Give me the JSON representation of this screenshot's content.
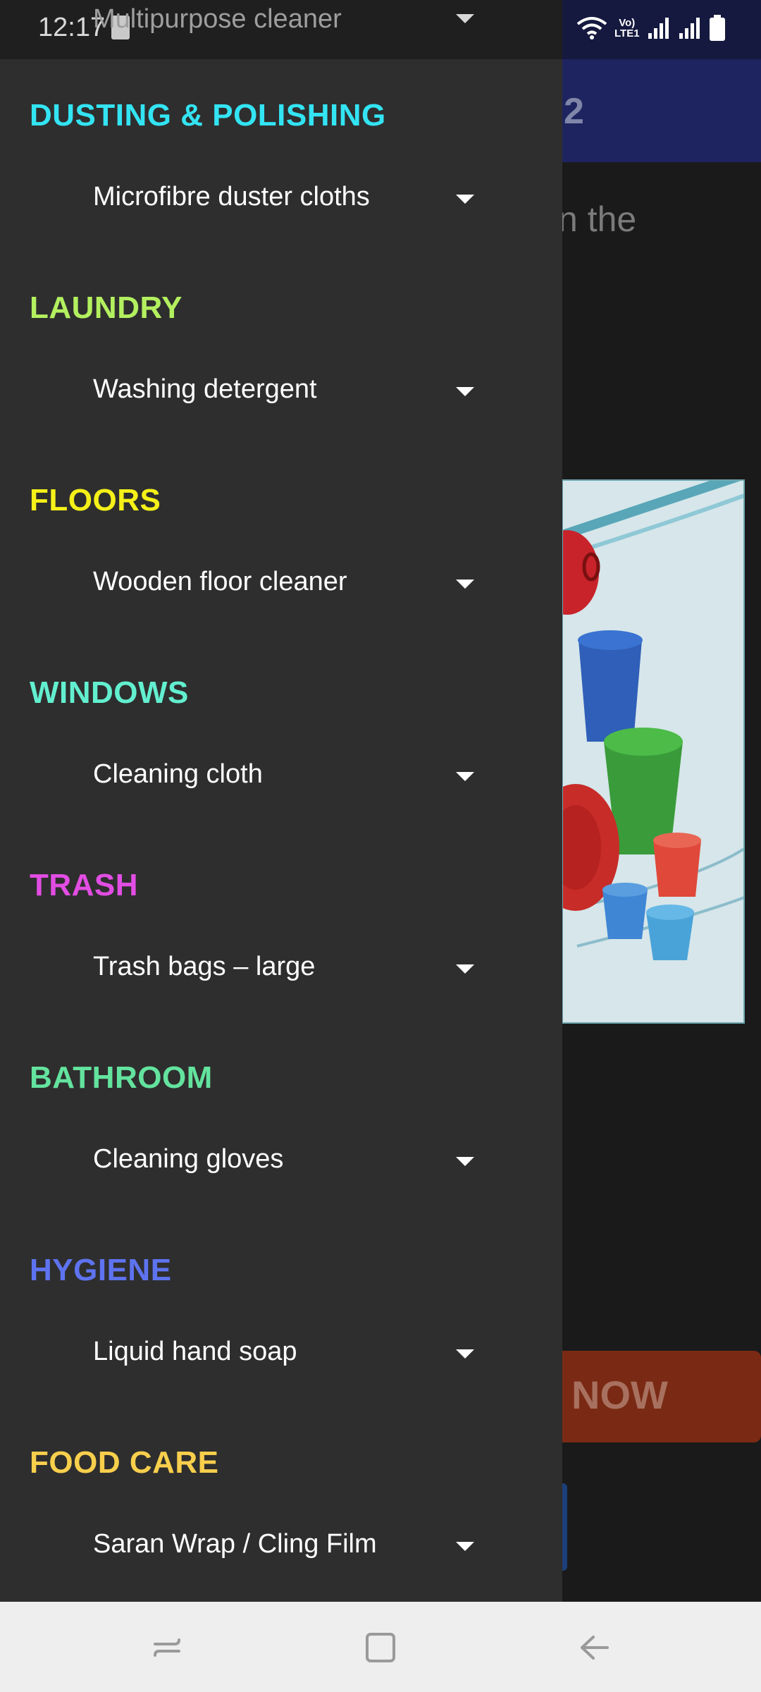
{
  "status_bar": {
    "time": "12:17",
    "network_label": "Vo)\nLTE1",
    "icons": [
      "notification-icon",
      "wifi-icon",
      "signal-sim1-icon",
      "signal-sim2-icon",
      "battery-icon"
    ]
  },
  "background_app": {
    "toolbar_title_fragment": "2",
    "description_fragment": "n the",
    "cta_label_fragment": "NOW"
  },
  "drawer": {
    "peek_item": {
      "label": "Multipurpose cleaner"
    },
    "sections": [
      {
        "title": "DUSTING & POLISHING",
        "color": "#33e4f3",
        "selected": "Microfibre duster cloths"
      },
      {
        "title": "LAUNDRY",
        "color": "#b3f05f",
        "selected": "Washing detergent"
      },
      {
        "title": "FLOORS",
        "color": "#f5f018",
        "selected": "Wooden floor cleaner"
      },
      {
        "title": "WINDOWS",
        "color": "#62efcf",
        "selected": "Cleaning cloth"
      },
      {
        "title": "TRASH",
        "color": "#e24de3",
        "selected": "Trash bags – large"
      },
      {
        "title": "BATHROOM",
        "color": "#63e39e",
        "selected": "Cleaning gloves"
      },
      {
        "title": "HYGIENE",
        "color": "#5e73f0",
        "selected": "Liquid hand soap"
      },
      {
        "title": "FOOD CARE",
        "color": "#f8cf4c",
        "selected": "Saran Wrap / Cling Film"
      }
    ]
  },
  "nav_bar": {
    "buttons": [
      "recents-icon",
      "home-icon",
      "back-icon"
    ]
  }
}
